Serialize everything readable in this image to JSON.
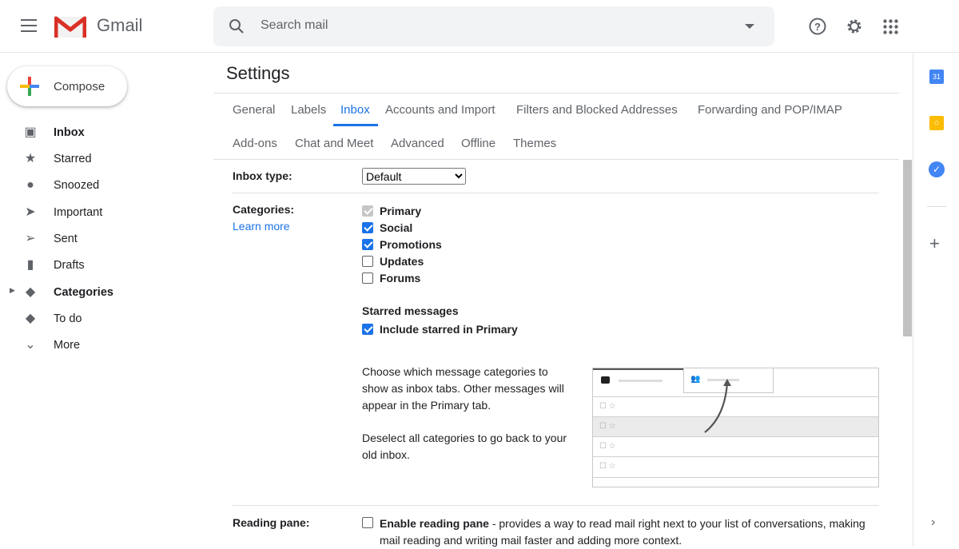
{
  "header": {
    "app_name": "Gmail",
    "search_placeholder": "Search mail"
  },
  "compose": "Compose",
  "sidebar": {
    "items": [
      {
        "label": "Inbox",
        "icon": "inbox-icon",
        "bold": true
      },
      {
        "label": "Starred",
        "icon": "star-icon"
      },
      {
        "label": "Snoozed",
        "icon": "clock-icon"
      },
      {
        "label": "Important",
        "icon": "important-icon"
      },
      {
        "label": "Sent",
        "icon": "send-icon"
      },
      {
        "label": "Drafts",
        "icon": "draft-icon"
      },
      {
        "label": "Categories",
        "icon": "label-icon",
        "bold": true
      },
      {
        "label": "To do",
        "icon": "label-icon"
      },
      {
        "label": "More",
        "icon": "chevron-down-icon"
      }
    ]
  },
  "settings": {
    "title": "Settings",
    "tabs_row1": [
      "General",
      "Labels",
      "Inbox",
      "Accounts and Import",
      "Filters and Blocked Addresses",
      "Forwarding and POP/IMAP"
    ],
    "tabs_row2": [
      "Add-ons",
      "Chat and Meet",
      "Advanced",
      "Offline",
      "Themes"
    ],
    "active_tab": "Inbox",
    "inbox_type": {
      "label": "Inbox type:",
      "value": "Default"
    },
    "categories": {
      "label": "Categories:",
      "learn_more": "Learn more",
      "items": [
        {
          "label": "Primary",
          "checked": true,
          "disabled": true
        },
        {
          "label": "Social",
          "checked": true
        },
        {
          "label": "Promotions",
          "checked": true
        },
        {
          "label": "Updates",
          "checked": false
        },
        {
          "label": "Forums",
          "checked": false
        }
      ],
      "starred_heading": "Starred messages",
      "starred_option": "Include starred in Primary",
      "starred_checked": true,
      "desc1": "Choose which message categories to show as inbox tabs. Other messages will appear in the Primary tab.",
      "desc2": "Deselect all categories to go back to your old inbox."
    },
    "reading_pane": {
      "label": "Reading pane:",
      "option": "Enable reading pane",
      "desc": " - provides a way to read mail right next to your list of conversations, making mail reading and writing mail faster and adding more context.",
      "checked": false
    }
  },
  "colors": {
    "accent": "#1a73e8"
  }
}
